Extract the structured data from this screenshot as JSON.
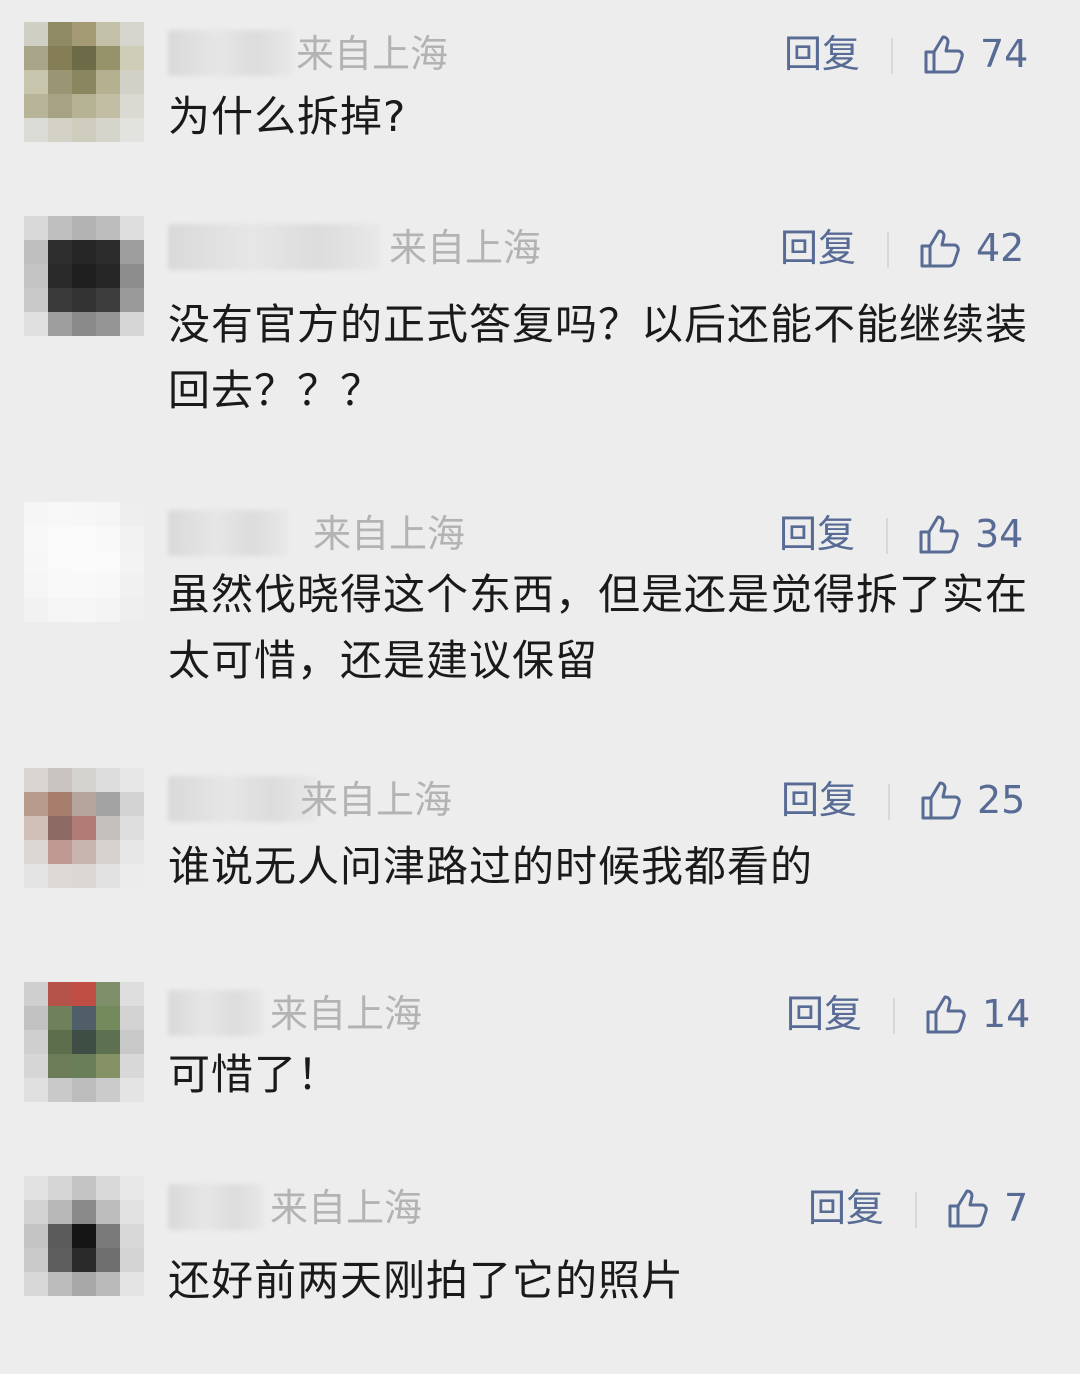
{
  "comments": [
    {
      "location": "来自上海",
      "reply_label": "回复",
      "likes": "74",
      "content": "为什么拆掉?",
      "avatar_colors": [
        "#cfcfc4",
        "#8f8a63",
        "#a49a73",
        "#c2c0a6",
        "#d6d6ce",
        "#a8a58a",
        "#857d56",
        "#6d6a48",
        "#96926a",
        "#cfccb8",
        "#c8c5ad",
        "#9a9673",
        "#8a8660",
        "#b4b090",
        "#d2d1c8",
        "#b8b49a",
        "#a6a283",
        "#b6b394",
        "#c1bea3",
        "#dadad2",
        "#dcdcd6",
        "#d4d2c6",
        "#cfcdbd",
        "#d6d5cb",
        "#e2e2de"
      ]
    },
    {
      "location": "来自上海",
      "reply_label": "回复",
      "likes": "42",
      "content": "没有官方的正式答复吗？以后还能不能继续装回去？？？",
      "avatar_colors": [
        "#d9d9d9",
        "#bfbfbf",
        "#b3b3b3",
        "#bdbdbd",
        "#dedede",
        "#bfbfbf",
        "#2e2e2e",
        "#262626",
        "#2c2c2c",
        "#9e9e9e",
        "#c4c4c4",
        "#2a2a2a",
        "#1e1e1e",
        "#262626",
        "#8c8c8c",
        "#c8c8c8",
        "#3a3a3a",
        "#323232",
        "#3c3c3c",
        "#9a9a9a",
        "#e0e0e0",
        "#9e9e9e",
        "#8a8a8a",
        "#959595",
        "#d6d6d6"
      ]
    },
    {
      "location": "来自上海",
      "reply_label": "回复",
      "likes": "34",
      "content": "虽然伐晓得这个东西，但是还是觉得拆了实在太可惜，还是建议保留",
      "avatar_colors": [
        "#f6f6f6",
        "#f8f8f8",
        "#f7f7f7",
        "#f5f5f5",
        "#eeeeee",
        "#f8f8f8",
        "#fafafa",
        "#fafafa",
        "#f9f9f9",
        "#f2f2f2",
        "#f7f7f7",
        "#fafafa",
        "#fbfbfb",
        "#fafafa",
        "#f3f3f3",
        "#f5f5f5",
        "#f9f9f9",
        "#f9f9f9",
        "#f8f8f8",
        "#f1f1f1",
        "#f2f2f2",
        "#f5f5f5",
        "#f6f6f6",
        "#f4f4f4",
        "#efefef"
      ]
    },
    {
      "location": "来自上海",
      "reply_label": "回复",
      "likes": "25",
      "content": "谁说无人问津路过的时候我都看的",
      "avatar_colors": [
        "#d9d6d2",
        "#c9c4c0",
        "#d4d2cf",
        "#dcdcdc",
        "#e6e6e6",
        "#b99b8b",
        "#a67c6b",
        "#b5a59c",
        "#a3a3a3",
        "#d2d2d2",
        "#d0bfb6",
        "#8a6a62",
        "#b27c76",
        "#c4c0bc",
        "#dedede",
        "#dcd6d2",
        "#c09a92",
        "#c8b4ae",
        "#d6d2ce",
        "#e6e6e6",
        "#e4e4e4",
        "#dcd9d6",
        "#d9d6d3",
        "#e1e1e1",
        "#ebebeb"
      ]
    },
    {
      "location": "来自上海",
      "reply_label": "回复",
      "likes": "14",
      "content": "可惜了！",
      "avatar_colors": [
        "#cfcfcf",
        "#b5524a",
        "#c04e44",
        "#7f8f6a",
        "#dedede",
        "#c2c2c2",
        "#6f805c",
        "#4f5e68",
        "#728a5c",
        "#d2d2d2",
        "#cfcfcf",
        "#5d6e4d",
        "#3f4e45",
        "#5d7050",
        "#c8c8c8",
        "#d6d6d6",
        "#6d7c58",
        "#6a7e5a",
        "#849266",
        "#d8d8d8",
        "#e0e0e0",
        "#c9c9c9",
        "#bdbdbd",
        "#cbcbcb",
        "#e4e4e4"
      ]
    },
    {
      "location": "来自上海",
      "reply_label": "回复",
      "likes": "7",
      "content": "还好前两天刚拍了它的照片",
      "avatar_colors": [
        "#e2e2e2",
        "#d6d6d6",
        "#c4c4c4",
        "#d9d9d9",
        "#e8e8e8",
        "#d2d2d2",
        "#b8b8b8",
        "#8a8a8a",
        "#bdbdbd",
        "#e2e2e2",
        "#c4c4c4",
        "#5a5a5a",
        "#141414",
        "#7a7a7a",
        "#d8d8d8",
        "#cacaca",
        "#5e5e5e",
        "#2a2a2a",
        "#6e6e6e",
        "#d4d4d4",
        "#d8d8d8",
        "#bcbcbc",
        "#a8a8a8",
        "#b9b9b9",
        "#e4e4e4"
      ]
    }
  ],
  "colors": {
    "background": "#ededed",
    "link": "#576b95",
    "meta": "#b3b3b3",
    "text": "#1a1a1a"
  }
}
